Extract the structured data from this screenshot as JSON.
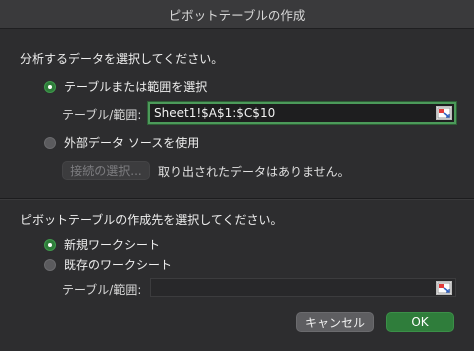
{
  "window": {
    "title": "ピボットテーブルの作成"
  },
  "data_section": {
    "heading": "分析するデータを選択してください。",
    "option_table": {
      "label": "テーブルまたは範囲を選択",
      "selected": true
    },
    "range_label": "テーブル/範囲:",
    "range_value": "Sheet1!$A$1:$C$10",
    "option_external": {
      "label": "外部データ ソースを使用",
      "selected": false
    },
    "choose_connection_button": "接続の選択...",
    "no_data_text": "取り出されたデータはありません。"
  },
  "destination_section": {
    "heading": "ピボットテーブルの作成先を選択してください。",
    "option_new_sheet": {
      "label": "新規ワークシート",
      "selected": true
    },
    "option_existing_sheet": {
      "label": "既存のワークシート",
      "selected": false
    },
    "range_label": "テーブル/範囲:",
    "range_value": ""
  },
  "footer": {
    "cancel_button": "キャンセル",
    "ok_button": "OK"
  },
  "colors": {
    "accent": "#2f7d3b",
    "background": "#2d2d2f"
  },
  "icons": {
    "range_picker": "collapse-dialog-icon"
  }
}
